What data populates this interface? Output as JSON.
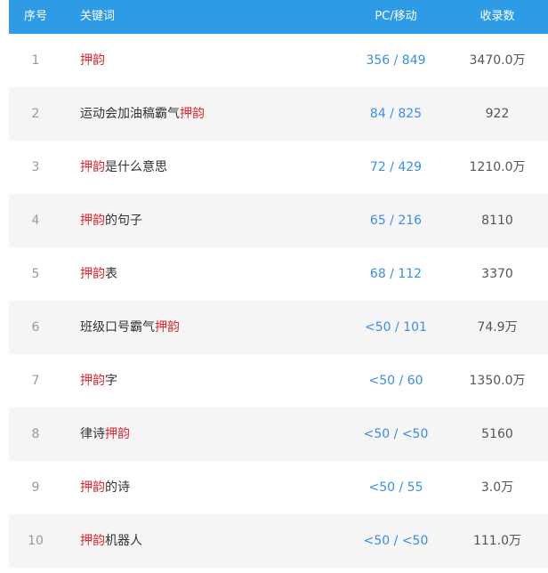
{
  "header": {
    "index": "序号",
    "keyword": "关键词",
    "pc_mobile": "PC/移动",
    "indexed": "收录数"
  },
  "colors": {
    "header_bg": "#2e9be6",
    "highlight": "#e0282e",
    "link": "#3a8ee6",
    "stripe": "#f5f5f5"
  },
  "rows": [
    {
      "index": "1",
      "pre": "",
      "highlight": "押韵",
      "post": "",
      "pc_mobile": "356 / 849",
      "indexed": "3470.0万"
    },
    {
      "index": "2",
      "pre": "运动会加油稿霸气",
      "highlight": "押韵",
      "post": "",
      "pc_mobile": "84 / 825",
      "indexed": "922"
    },
    {
      "index": "3",
      "pre": "",
      "highlight": "押韵",
      "post": "是什么意思",
      "pc_mobile": "72 / 429",
      "indexed": "1210.0万"
    },
    {
      "index": "4",
      "pre": "",
      "highlight": "押韵",
      "post": "的句子",
      "pc_mobile": "65 / 216",
      "indexed": "8110"
    },
    {
      "index": "5",
      "pre": "",
      "highlight": "押韵",
      "post": "表",
      "pc_mobile": "68 / 112",
      "indexed": "3370"
    },
    {
      "index": "6",
      "pre": "班级口号霸气",
      "highlight": "押韵",
      "post": "",
      "pc_mobile": "<50 / 101",
      "indexed": "74.9万"
    },
    {
      "index": "7",
      "pre": "",
      "highlight": "押韵",
      "post": "字",
      "pc_mobile": "<50 / 60",
      "indexed": "1350.0万"
    },
    {
      "index": "8",
      "pre": "律诗",
      "highlight": "押韵",
      "post": "",
      "pc_mobile": "<50 / <50",
      "indexed": "5160"
    },
    {
      "index": "9",
      "pre": "",
      "highlight": "押韵",
      "post": "的诗",
      "pc_mobile": "<50 / 55",
      "indexed": "3.0万"
    },
    {
      "index": "10",
      "pre": "",
      "highlight": "押韵",
      "post": "机器人",
      "pc_mobile": "<50 / <50",
      "indexed": "111.0万"
    }
  ]
}
